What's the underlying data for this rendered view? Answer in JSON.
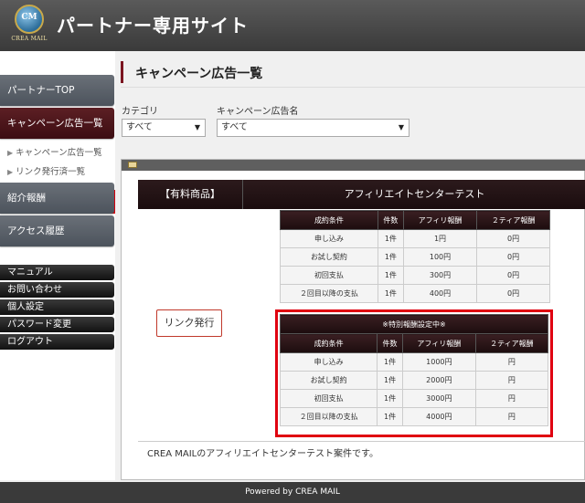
{
  "header": {
    "title": "パートナー専用サイト",
    "logo_mark": "CM",
    "logo_text": "CREA MAIL"
  },
  "sidebar": {
    "top": "パートナーTOP",
    "campaign": "キャンペーン広告一覧",
    "sub_items": [
      "キャンペーン広告一覧",
      "リンク発行済一覧"
    ],
    "referral": "紹介報酬",
    "access": "アクセス履歴",
    "util_items": [
      "マニュアル",
      "お問い合わせ",
      "個人設定",
      "パスワード変更",
      "ログアウト"
    ]
  },
  "main": {
    "page_title": "キャンペーン広告一覧",
    "category_label": "カテゴリ",
    "category_value": "すべて",
    "campaign_label": "キャンペーン広告名",
    "campaign_value": "すべて"
  },
  "campaign": {
    "type": "【有料商品】",
    "name": "アフィリエイトセンターテスト",
    "link_button": "リンク発行",
    "headers": [
      "成約条件",
      "件数",
      "アフィリ報酬",
      "２ティア報酬"
    ],
    "rows": [
      [
        "申し込み",
        "1件",
        "1円",
        "0円"
      ],
      [
        "お試し契約",
        "1件",
        "100円",
        "0円"
      ],
      [
        "初回支払",
        "1件",
        "300円",
        "0円"
      ],
      [
        "２回目以降の支払",
        "1件",
        "400円",
        "0円"
      ]
    ],
    "special_title": "※特別報酬設定中※",
    "special_rows": [
      [
        "申し込み",
        "1件",
        "1000円",
        "円"
      ],
      [
        "お試し契約",
        "1件",
        "2000円",
        "円"
      ],
      [
        "初回支払",
        "1件",
        "3000円",
        "円"
      ],
      [
        "２回目以降の支払",
        "1件",
        "4000円",
        "円"
      ]
    ],
    "description": "CREA MAILのアフィリエイトセンターテスト案件です。"
  },
  "footer": {
    "text": "Powered by CREA MAIL"
  }
}
